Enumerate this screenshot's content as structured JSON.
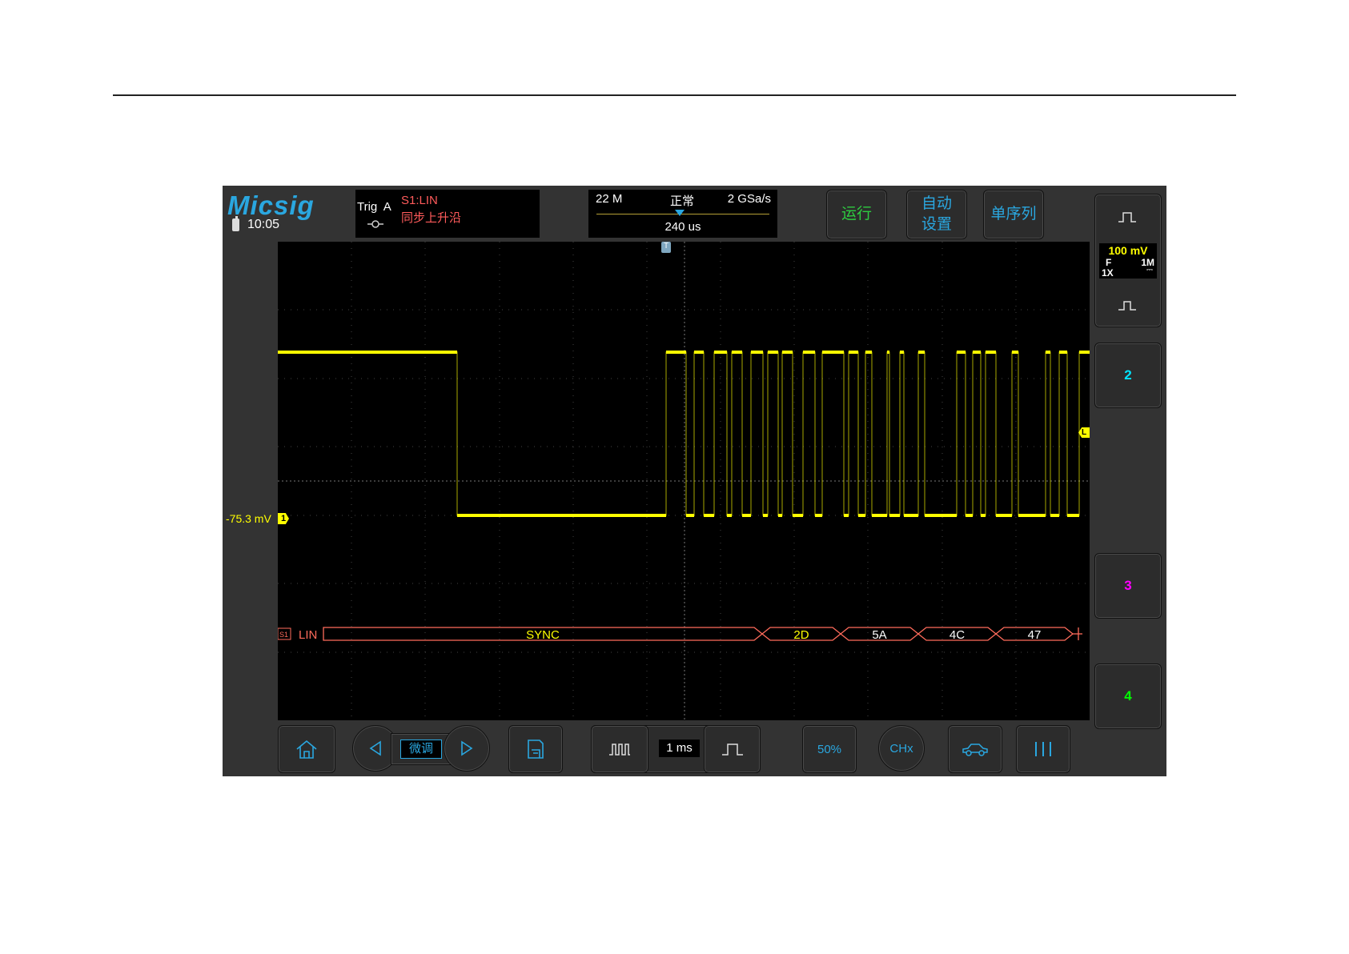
{
  "logo": "Micsig",
  "status": {
    "time": "10:05"
  },
  "trigger": {
    "label": "Trig",
    "mode": "A",
    "source": "S1:LIN",
    "condition": "同步上升沿"
  },
  "timebase": {
    "memory_depth": "22 M",
    "acq_mode": "正常",
    "sample_rate": "2 GSa/s",
    "delay": "240 us"
  },
  "top_buttons": {
    "run": "运行",
    "auto_line1": "自动",
    "auto_line2": "设置",
    "single": "单序列"
  },
  "colors": {
    "ch1": "#ffff00",
    "ch2": "#00e5ff",
    "ch3": "#ff00ff",
    "ch4": "#00ff00",
    "decode": "#ff6b5b",
    "accent": "#2aa7e0",
    "run": "#2ecc40"
  },
  "channel1": {
    "offset": "-75.3 mV",
    "marker": "1",
    "scale": "100 mV",
    "bw_limit": "F",
    "impedance": "1M",
    "probe": "1X",
    "coupling": "⎓"
  },
  "markers": {
    "trigger_pos": "T",
    "level": "L"
  },
  "side_channels": {
    "ch2": "2",
    "ch3": "3",
    "ch4": "4"
  },
  "decode": {
    "bus_tag": "S1",
    "protocol": "LIN",
    "frames": [
      {
        "label": "SYNC",
        "highlight": true
      },
      {
        "label": "2D",
        "highlight": true
      },
      {
        "label": "5A",
        "highlight": false
      },
      {
        "label": "4C",
        "highlight": false
      },
      {
        "label": "47",
        "highlight": false
      }
    ]
  },
  "bottom_bar": {
    "fine_label": "微调",
    "time_per_div": "1 ms",
    "fifty_percent": "50%",
    "channel_select": "CHx"
  },
  "icons": {
    "home": "home-icon",
    "left": "left-arrow-icon",
    "right": "right-arrow-icon",
    "save": "save-icon",
    "zoom_out": "wide-pulse-icon",
    "zoom_in": "narrow-pulse-icon",
    "car": "car-icon",
    "menu": "menu-bars-icon"
  }
}
